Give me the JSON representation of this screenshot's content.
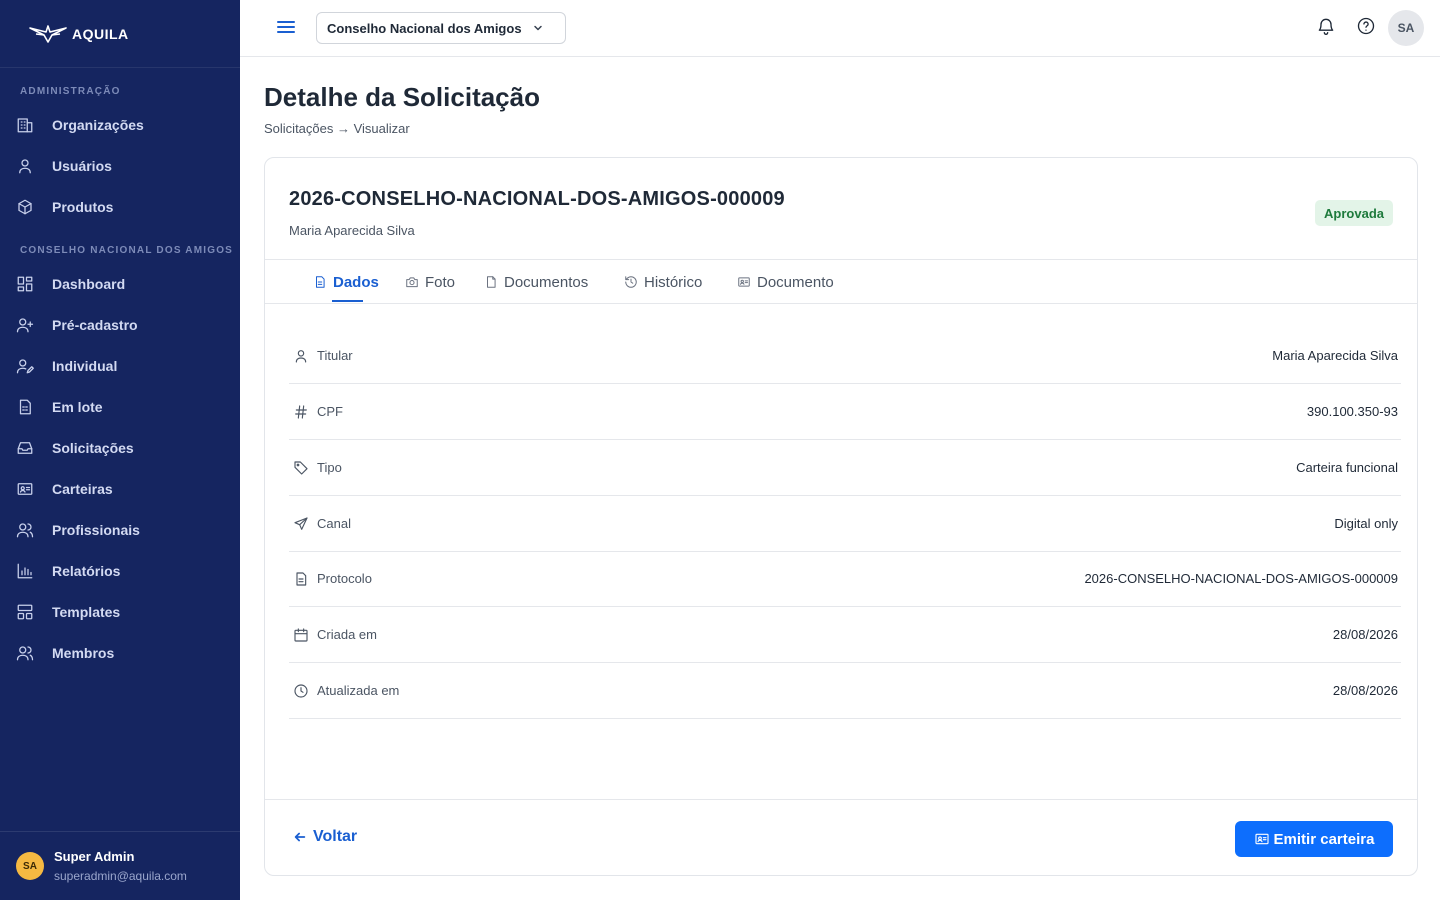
{
  "app": {
    "brand": "AQUILA"
  },
  "sidebar": {
    "sections": [
      {
        "title": "ADMINISTRAÇÃO",
        "items": [
          "Organizações",
          "Usuários",
          "Produtos"
        ]
      },
      {
        "title": "CONSELHO NACIONAL DOS AMIGOS",
        "items": [
          "Dashboard",
          "Pré-cadastro",
          "Individual",
          "Em lote",
          "Solicitações",
          "Carteiras",
          "Profissionais",
          "Relatórios",
          "Templates",
          "Membros"
        ]
      }
    ],
    "icons": [
      "building-icon",
      "user-icon",
      "package-icon",
      "dashboard-icon",
      "user-plus-icon",
      "user-edit-icon",
      "file-sheet-icon",
      "inbox-icon",
      "id-card-icon",
      "users-icon",
      "bar-chart-icon",
      "template-icon",
      "members-icon"
    ],
    "user": {
      "initials": "SA",
      "name": "Super Admin",
      "email": "superadmin@aquila.com"
    }
  },
  "topbar": {
    "org_select": "Conselho Nacional dos Amigos",
    "avatar_initials": "SA"
  },
  "page": {
    "title": "Detalhe da Solicitação",
    "breadcrumb": "Solicitações → Visualizar"
  },
  "request": {
    "id": "2026-CONSELHO-NACIONAL-DOS-AMIGOS-000009",
    "holder": "Maria Aparecida Silva",
    "status": "Aprovada",
    "status_color": "#1e7a3c"
  },
  "tabs": [
    {
      "label": "Dados",
      "icon": "file-text-icon",
      "active": true
    },
    {
      "label": "Foto",
      "icon": "camera-icon",
      "active": false
    },
    {
      "label": "Documentos",
      "icon": "file-icon",
      "active": false
    },
    {
      "label": "Histórico",
      "icon": "history-icon",
      "active": false
    },
    {
      "label": "Documento",
      "icon": "id-card-icon",
      "active": false
    }
  ],
  "details": [
    {
      "label": "Titular",
      "value": "Maria Aparecida Silva",
      "icon": "user-icon"
    },
    {
      "label": "CPF",
      "value": "390.100.350-93",
      "icon": "hash-icon"
    },
    {
      "label": "Tipo",
      "value": "Carteira funcional",
      "icon": "tag-icon"
    },
    {
      "label": "Canal",
      "value": "Digital only",
      "icon": "send-icon"
    },
    {
      "label": "Protocolo",
      "value": "2026-CONSELHO-NACIONAL-DOS-AMIGOS-000009",
      "icon": "file-text-icon"
    },
    {
      "label": "Criada em",
      "value": "28/08/2026",
      "icon": "calendar-icon"
    },
    {
      "label": "Atualizada em",
      "value": "28/08/2026",
      "icon": "clock-icon"
    }
  ],
  "actions": {
    "back": "Voltar",
    "emit": "Emitir carteira"
  },
  "colors": {
    "sidebar_bg": "#152560",
    "primary": "#0d6efd",
    "link": "#1a5fd1"
  }
}
